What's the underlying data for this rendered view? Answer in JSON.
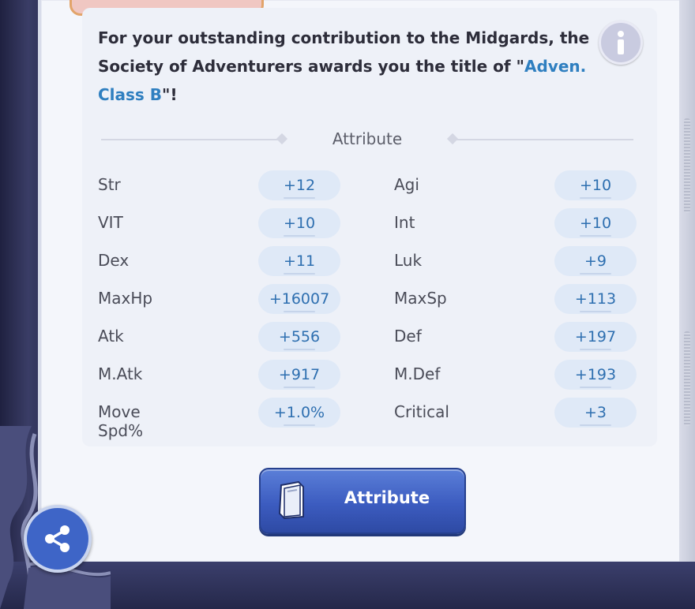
{
  "message": {
    "prefix": "For your outstanding contribution to the Midgards, the Society of Adventurers awards you the title of \"",
    "highlight": "Adven. Class B",
    "suffix": "\"!"
  },
  "section_title": "Attribute",
  "attributes": [
    {
      "name": "Str",
      "value": "+12",
      "name2": "Agi",
      "value2": "+10"
    },
    {
      "name": "VIT",
      "value": "+10",
      "name2": "Int",
      "value2": "+10"
    },
    {
      "name": "Dex",
      "value": "+11",
      "name2": "Luk",
      "value2": "+9"
    },
    {
      "name": "MaxHp",
      "value": "+16007",
      "name2": "MaxSp",
      "value2": "+113"
    },
    {
      "name": "Atk",
      "value": "+556",
      "name2": "Def",
      "value2": "+197"
    },
    {
      "name": "M.Atk",
      "value": "+917",
      "name2": "M.Def",
      "value2": "+193"
    },
    {
      "name": "Move Spd%",
      "value": "+1.0%",
      "name2": "Critical",
      "value2": "+3"
    }
  ],
  "button": {
    "label": "Attribute",
    "icon": "book-icon"
  },
  "share": {
    "icon": "share-icon"
  },
  "info": {
    "icon": "info-icon"
  },
  "colors": {
    "highlight": "#2f7fc0",
    "pill_bg": "#dfe9f7",
    "pill_text": "#2e6fb0",
    "button": "#3c5cc0"
  }
}
